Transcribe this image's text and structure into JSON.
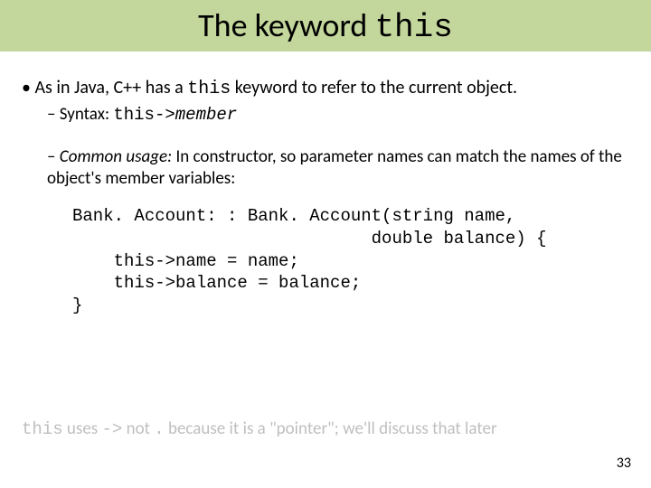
{
  "title_a": "The keyword ",
  "title_b": "this",
  "b1_a": "As in Java, C++ has a ",
  "b1_b": "this",
  "b1_c": " keyword to refer to the current object.",
  "syntax_a": "Syntax:  ",
  "syntax_b": "this->",
  "syntax_c": "member",
  "usage_a": "Common usage:",
  "usage_b": " In constructor, so parameter names can match the names of the object's member variables:",
  "code": "Bank. Account: : Bank. Account(string name,\n                             double balance) {\n    this->name = name;\n    this->balance = balance;\n}",
  "foot_a": "this",
  "foot_b": " uses ",
  "foot_c": "->",
  "foot_d": " not ",
  "foot_e": ".",
  "foot_f": "  because it is a \"pointer\";  we'll discuss that later",
  "page": "33"
}
